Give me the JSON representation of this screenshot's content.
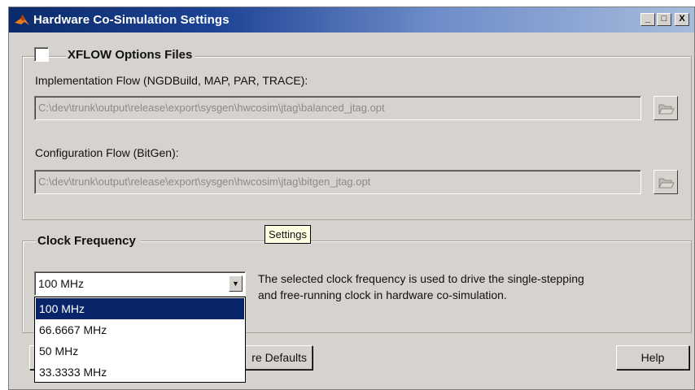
{
  "window": {
    "title": "Hardware Co-Simulation Settings",
    "controls": [
      "_",
      "□",
      "X"
    ]
  },
  "xflow": {
    "checkbox_label": "XFLOW Options Files",
    "checked": false,
    "impl_label": "Implementation Flow (NGDBuild, MAP, PAR, TRACE):",
    "impl_value": "C:\\dev\\trunk\\output\\release\\export\\sysgen\\hwcosim\\jtag\\balanced_jtag.opt",
    "config_label": "Configuration Flow (BitGen):",
    "config_value": "C:\\dev\\trunk\\output\\release\\export\\sysgen\\hwcosim\\jtag\\bitgen_jtag.opt"
  },
  "tooltip": "Settings",
  "clock": {
    "title": "Clock Frequency",
    "selected": "100 MHz",
    "options": [
      "100 MHz",
      "66.6667 MHz",
      "50 MHz",
      "33.3333 MHz"
    ],
    "description_line1": "The selected clock frequency is used to drive the single-stepping",
    "description_line2": "and free-running clock in hardware co-simulation."
  },
  "buttons": {
    "restore_defaults": "re Defaults",
    "help": "Help"
  },
  "icons": {
    "app": "matlab-icon",
    "browse": "folder-open-icon",
    "combo": "chevron-down-icon"
  }
}
